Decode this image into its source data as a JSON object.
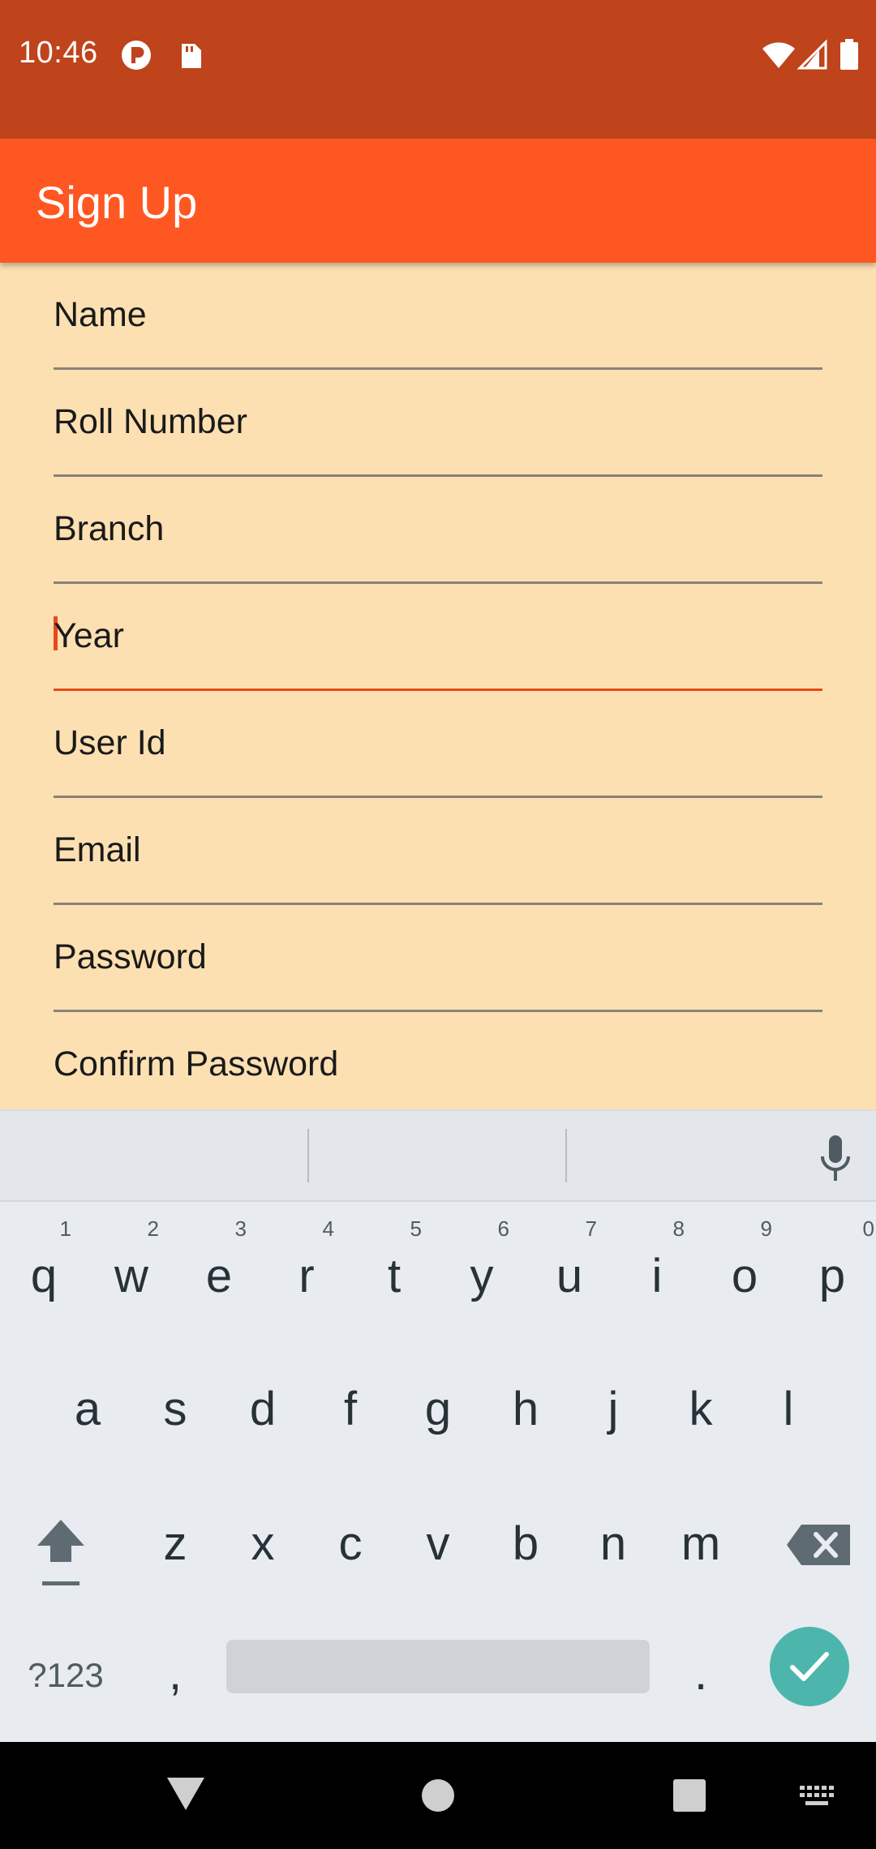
{
  "status_bar": {
    "time": "10:46"
  },
  "app_bar": {
    "title": "Sign Up"
  },
  "form": {
    "fields": [
      {
        "label": "Name"
      },
      {
        "label": "Roll Number"
      },
      {
        "label": "Branch"
      },
      {
        "label": "Year"
      },
      {
        "label": "User Id"
      },
      {
        "label": "Email"
      },
      {
        "label": "Password"
      },
      {
        "label": "Confirm Password"
      }
    ]
  },
  "keyboard": {
    "row1": [
      "q",
      "w",
      "e",
      "r",
      "t",
      "y",
      "u",
      "i",
      "o",
      "p"
    ],
    "row1_numbers": [
      "1",
      "2",
      "3",
      "4",
      "5",
      "6",
      "7",
      "8",
      "9",
      "0"
    ],
    "row2": [
      "a",
      "s",
      "d",
      "f",
      "g",
      "h",
      "j",
      "k",
      "l"
    ],
    "row3": [
      "z",
      "x",
      "c",
      "v",
      "b",
      "n",
      "m"
    ],
    "symbols_label": "?123",
    "comma": ",",
    "period": "."
  },
  "colors": {
    "status_bar": "#BF431B",
    "app_bar": "#FF5722",
    "form_background": "#FDE0B2",
    "focus_accent": "#E64A19",
    "enter_key": "#4DB6AC"
  }
}
